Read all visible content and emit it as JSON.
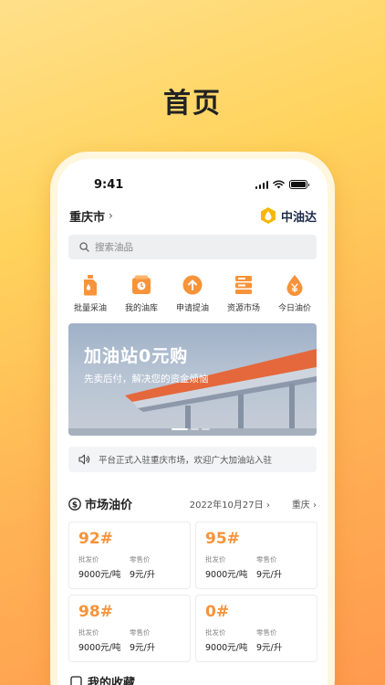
{
  "promo": {
    "title": "首页"
  },
  "status_bar": {
    "time": "9:41"
  },
  "header": {
    "city": "重庆市",
    "brand_name": "中油达"
  },
  "search": {
    "placeholder": "搜索油品"
  },
  "quick_actions": [
    {
      "label": "批量采油",
      "icon": "oil-can-icon"
    },
    {
      "label": "我的油库",
      "icon": "depot-icon"
    },
    {
      "label": "申请提油",
      "icon": "upload-arrow-icon"
    },
    {
      "label": "资源市场",
      "icon": "storage-rack-icon"
    },
    {
      "label": "今日油价",
      "icon": "price-drop-icon"
    }
  ],
  "banner": {
    "title": "加油站0元购",
    "subtitle": "先卖后付，解决您的资金烦恼"
  },
  "notice": {
    "text": "平台正式入驻重庆市场，欢迎广大加油站入驻"
  },
  "market": {
    "title": "市场油价",
    "date": "2022年10月27日",
    "region": "重庆",
    "wholesale_label": "批发价",
    "retail_label": "零售价",
    "products": [
      {
        "grade": "92#",
        "wholesale": "9000元/吨",
        "retail": "9元/升"
      },
      {
        "grade": "95#",
        "wholesale": "9000元/吨",
        "retail": "9元/升"
      },
      {
        "grade": "98#",
        "wholesale": "9000元/吨",
        "retail": "9元/升"
      },
      {
        "grade": "0#",
        "wholesale": "9000元/吨",
        "retail": "9元/升"
      }
    ]
  },
  "next_section": {
    "title": "我的收藏"
  },
  "colors": {
    "accent": "#f7933a",
    "brand_gold": "#f5b800"
  }
}
